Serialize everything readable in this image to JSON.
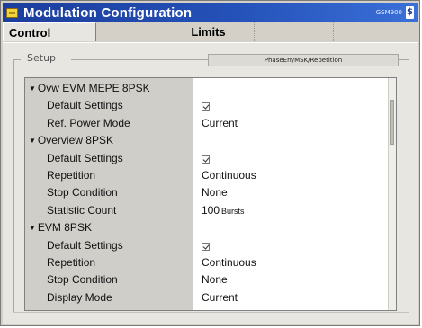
{
  "window": {
    "title": "Modulation Configuration",
    "mode_label": "GSM900",
    "mode_badge": "$"
  },
  "tabs": [
    {
      "label": "Control",
      "active": true
    },
    {
      "label": "",
      "active": false
    },
    {
      "label": "Limits",
      "active": false
    },
    {
      "label": "",
      "active": false
    },
    {
      "label": "",
      "active": false
    }
  ],
  "setup": {
    "label": "Setup",
    "status": "PhaseErr/MSK/Repetition"
  },
  "tree": {
    "groups": [
      {
        "label": "Ovw EVM MEPE 8PSK",
        "items": [
          {
            "label": "Default Settings",
            "value": "",
            "type": "checkbox",
            "checked": true
          },
          {
            "label": "Ref. Power Mode",
            "value": "Current",
            "type": "text"
          }
        ]
      },
      {
        "label": "Overview 8PSK",
        "items": [
          {
            "label": "Default Settings",
            "value": "",
            "type": "checkbox",
            "checked": true
          },
          {
            "label": "Repetition",
            "value": "Continuous",
            "type": "text"
          },
          {
            "label": "Stop Condition",
            "value": "None",
            "type": "text"
          },
          {
            "label": "Statistic Count",
            "value": "100",
            "unit": "Bursts",
            "type": "text"
          }
        ]
      },
      {
        "label": "EVM 8PSK",
        "items": [
          {
            "label": "Default Settings",
            "value": "",
            "type": "checkbox",
            "checked": true
          },
          {
            "label": "Repetition",
            "value": "Continuous",
            "type": "text"
          },
          {
            "label": "Stop Condition",
            "value": "None",
            "type": "text"
          },
          {
            "label": "Display Mode",
            "value": "Current",
            "type": "text"
          }
        ]
      }
    ],
    "scroll_position": 0.1
  },
  "colors": {
    "titlebar": "#2451b8",
    "panel": "#e8e6e0",
    "label_column": "#d0cec8"
  },
  "icons": {
    "window": "window-icon",
    "expand": "expanded-arrow-icon",
    "check": "checkbox-checked-icon"
  }
}
